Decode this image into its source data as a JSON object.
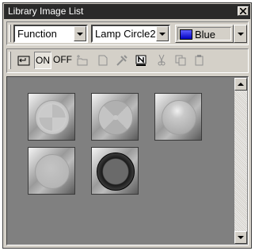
{
  "window": {
    "title": "Library Image List",
    "close_icon": "close-icon"
  },
  "combos": {
    "category": {
      "value": "Function"
    },
    "image": {
      "value": "Lamp Circle2"
    },
    "color": {
      "value": "Blue",
      "swatch": "#0000ff"
    }
  },
  "toolbar": {
    "buttons": [
      {
        "name": "up-folder-icon"
      },
      {
        "name": "on-button",
        "label": "ON",
        "pressed": true
      },
      {
        "name": "off-button",
        "label": "OFF"
      },
      {
        "name": "new-folder-icon"
      },
      {
        "name": "new-file-icon"
      },
      {
        "name": "tools-icon"
      },
      {
        "name": "rename-icon"
      },
      {
        "name": "cut-icon"
      },
      {
        "name": "copy-icon"
      },
      {
        "name": "paste-icon"
      }
    ]
  },
  "images": [
    {
      "name": "lamp-circle-style-1"
    },
    {
      "name": "lamp-circle-style-2"
    },
    {
      "name": "lamp-circle-style-3"
    },
    {
      "name": "lamp-circle-style-4"
    },
    {
      "name": "lamp-circle-style-5"
    }
  ],
  "colors": {
    "titlebar": "#2a2a2a",
    "panel": "#d4d0c8",
    "content_background": "#808080"
  }
}
